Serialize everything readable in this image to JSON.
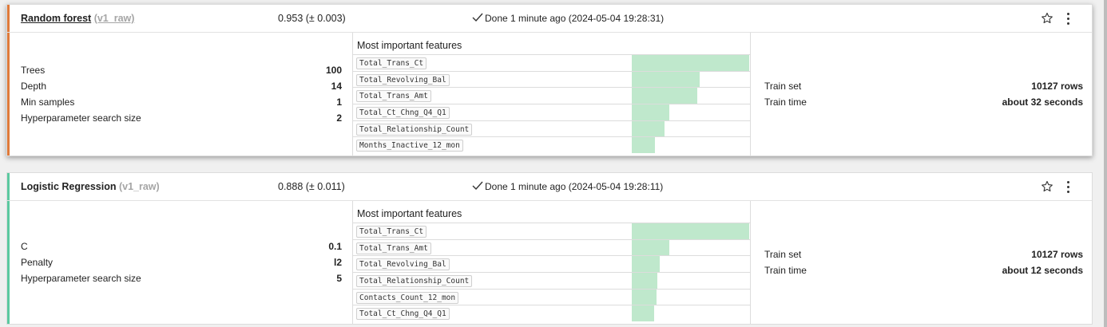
{
  "models": [
    {
      "name": "Random forest",
      "tag": "(v1_raw)",
      "score": "0.953 (± 0.003)",
      "status": "Done 1 minute ago (2024-05-04 19:28:31)",
      "accent_color": "#e07a3a",
      "params": [
        {
          "label": "Trees",
          "value": "100"
        },
        {
          "label": "Depth",
          "value": "14"
        },
        {
          "label": "Min samples",
          "value": "1"
        },
        {
          "label": "Hyperparameter search size",
          "value": "2"
        }
      ],
      "features_title": "Most important features",
      "features": [
        {
          "name": "Total_Trans_Ct",
          "importance": 1.0
        },
        {
          "name": "Total_Revolving_Bal",
          "importance": 0.58
        },
        {
          "name": "Total_Trans_Amt",
          "importance": 0.56
        },
        {
          "name": "Total_Ct_Chng_Q4_Q1",
          "importance": 0.32
        },
        {
          "name": "Total_Relationship_Count",
          "importance": 0.28
        },
        {
          "name": "Months_Inactive_12_mon",
          "importance": 0.2
        }
      ],
      "train": [
        {
          "label": "Train set",
          "value": "10127 rows"
        },
        {
          "label": "Train time",
          "value": "about 32 seconds"
        }
      ]
    },
    {
      "name": "Logistic Regression",
      "tag": "(v1_raw)",
      "score": "0.888 (± 0.011)",
      "status": "Done 1 minute ago (2024-05-04 19:28:11)",
      "accent_color": "#5cc9a0",
      "params": [
        {
          "label": "C",
          "value": "0.1"
        },
        {
          "label": "Penalty",
          "value": "l2"
        },
        {
          "label": "Hyperparameter search size",
          "value": "5"
        }
      ],
      "features_title": "Most important features",
      "features": [
        {
          "name": "Total_Trans_Ct",
          "importance": 1.0
        },
        {
          "name": "Total_Trans_Amt",
          "importance": 0.32
        },
        {
          "name": "Total_Revolving_Bal",
          "importance": 0.24
        },
        {
          "name": "Total_Relationship_Count",
          "importance": 0.22
        },
        {
          "name": "Contacts_Count_12_mon",
          "importance": 0.21
        },
        {
          "name": "Total_Ct_Chng_Q4_Q1",
          "importance": 0.19
        }
      ],
      "train": [
        {
          "label": "Train set",
          "value": "10127 rows"
        },
        {
          "label": "Train time",
          "value": "about 12 seconds"
        }
      ]
    }
  ],
  "icons": {
    "status": "checkmark-icon",
    "favorite": "star-outline-icon",
    "menu": "kebab-menu-icon"
  }
}
